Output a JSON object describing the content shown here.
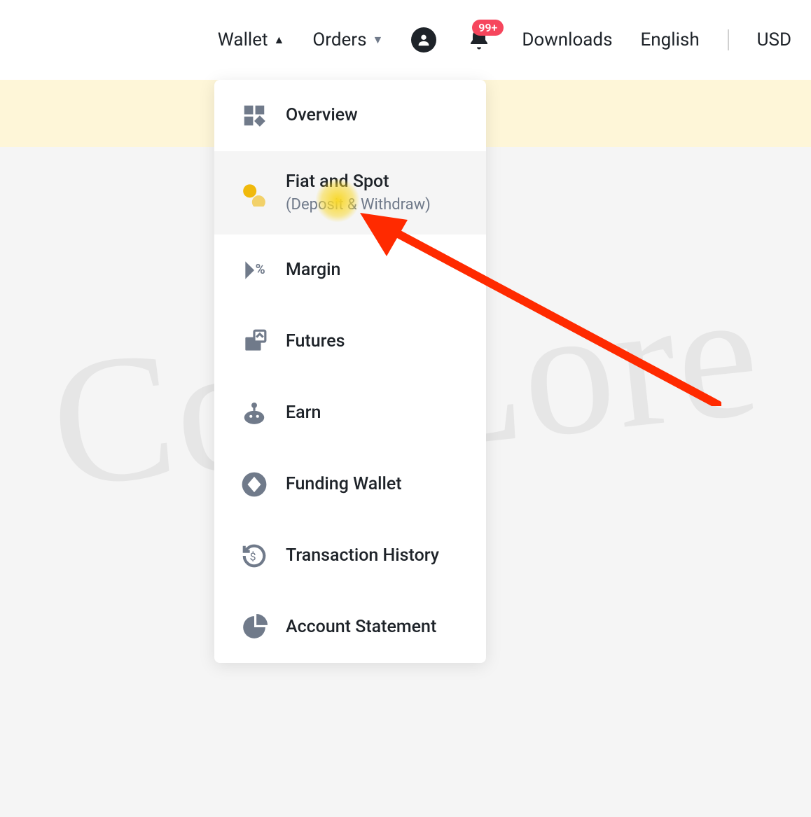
{
  "nav": {
    "wallet": "Wallet",
    "orders": "Orders",
    "downloads": "Downloads",
    "language": "English",
    "currency": "USD",
    "badge": "99+"
  },
  "wallet_menu": {
    "items": [
      {
        "label": "Overview",
        "sub": ""
      },
      {
        "label": "Fiat and Spot",
        "sub": "(Deposit & Withdraw)"
      },
      {
        "label": "Margin",
        "sub": ""
      },
      {
        "label": "Futures",
        "sub": ""
      },
      {
        "label": "Earn",
        "sub": ""
      },
      {
        "label": "Funding Wallet",
        "sub": ""
      },
      {
        "label": "Transaction History",
        "sub": ""
      },
      {
        "label": "Account Statement",
        "sub": ""
      }
    ]
  },
  "watermark": "CoinLore"
}
